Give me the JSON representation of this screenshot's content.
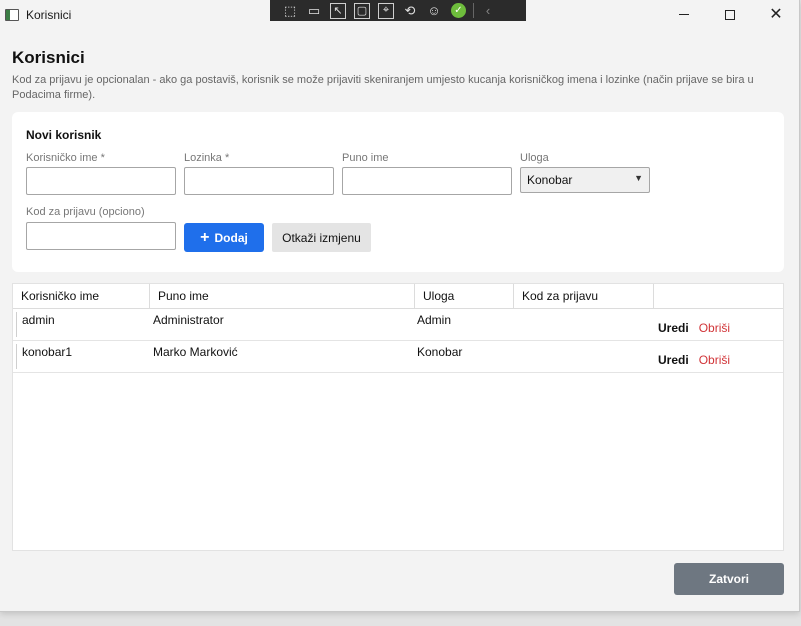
{
  "window": {
    "title": "Korisnici",
    "controls": {
      "minimize": "minimize-icon",
      "maximize": "maximize-icon",
      "close": "close-icon"
    }
  },
  "debug_toolbar": {
    "icons": [
      "select-element-icon",
      "record-icon",
      "pointer-select-icon",
      "layout-adorner-icon",
      "track-focus-icon",
      "hot-reload-icon",
      "accessibility-icon",
      "check-icon",
      "collapse-chevron-icon"
    ]
  },
  "page": {
    "title": "Korisnici",
    "description": "Kod za prijavu je opcionalan - ako ga postaviš, korisnik se može prijaviti skeniranjem umjesto kucanja korisničkog imena i lozinke (način prijave se bira u Podacima firme)."
  },
  "form": {
    "title": "Novi korisnik",
    "username_label": "Korisničko ime *",
    "username_value": "",
    "password_label": "Lozinka *",
    "password_value": "",
    "fullname_label": "Puno ime",
    "fullname_value": "",
    "role_label": "Uloga",
    "role_value": "Konobar",
    "code_label": "Kod za prijavu (opciono)",
    "code_value": "",
    "add_button": "Dodaj",
    "cancel_button": "Otkaži izmjenu"
  },
  "table": {
    "columns": [
      "Korisničko ime",
      "Puno ime",
      "Uloga",
      "Kod za prijavu",
      ""
    ],
    "rows": [
      {
        "username": "admin",
        "fullname": "Administrator",
        "role": "Admin",
        "code": "",
        "edit": "Uredi",
        "delete": "Obriši"
      },
      {
        "username": "konobar1",
        "fullname": "Marko Marković",
        "role": "Konobar",
        "code": "",
        "edit": "Uredi",
        "delete": "Obriši"
      }
    ]
  },
  "footer": {
    "close_button": "Zatvori"
  },
  "colors": {
    "primary": "#1f6feb",
    "danger": "#d13438",
    "close_button": "#6e7781"
  }
}
